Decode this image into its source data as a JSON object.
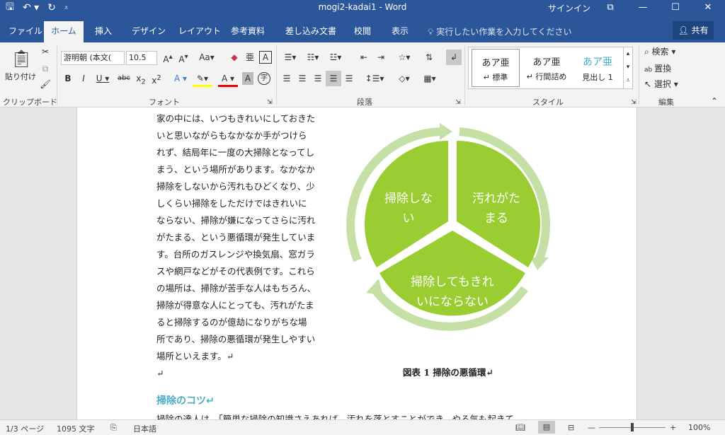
{
  "window": {
    "title": "mogi2-kadai1  -  Word",
    "signin": "サインイン"
  },
  "tabs": [
    "ファイル",
    "ホーム",
    "挿入",
    "デザイン",
    "レイアウト",
    "参考資料",
    "差し込み文書",
    "校閲",
    "表示"
  ],
  "tellme": "実行したい作業を入力してください",
  "share": "共有",
  "ribbon": {
    "clipboard": {
      "paste": "貼り付け",
      "label": "クリップボード"
    },
    "font": {
      "name": "游明朝 (本文(",
      "size": "10.5",
      "label": "フォント"
    },
    "paragraph": {
      "label": "段落"
    },
    "styles": {
      "label": "スタイル",
      "items": [
        {
          "sample": "あア亜",
          "name": "↵ 標準"
        },
        {
          "sample": "あア亜",
          "name": "↵ 行間詰め"
        },
        {
          "sample": "あア亜",
          "name": "見出し 1"
        }
      ]
    },
    "editing": {
      "search": "検索",
      "replace": "置換",
      "select": "選択",
      "label": "編集"
    }
  },
  "document": {
    "lines": [
      "家の中には、いつもきれいにしておきた",
      "いと思いながらもなかなか手がつけら",
      "れず、結局年に一度の大掃除となってし",
      "まう、という場所があります。なかなか",
      "掃除をしないから汚れもひどくなり、少",
      "しくらい掃除をしただけではきれいに",
      "ならない、掃除が嫌になってさらに汚れ",
      "がたまる、という悪循環が発生していま",
      "す。台所のガスレンジや換気扇、窓ガラ",
      "スや網戸などがその代表例です。これら",
      "の場所は、掃除が苦手な人はもちろん、",
      "掃除が得意な人にとっても、汚れがたま",
      "ると掃除するのが億劫になりがちな場",
      "所であり、掃除の悪循環が発生しやすい",
      "場所といえます。↵",
      "↵"
    ],
    "cycle": [
      {
        "line1": "汚れがた",
        "line2": "まる"
      },
      {
        "line1": "掃除してもきれ",
        "line2": "いにならない"
      },
      {
        "line1": "掃除しな",
        "line2": "い"
      }
    ],
    "caption": "図表 1 掃除の悪循環↵",
    "heading": "掃除のコツ↵",
    "next_line": "掃除の達人は、「簡単な掃除の知識さえあれば、汚れを落とすことができ、やる気も起きて"
  },
  "colors": {
    "brand": "#2b579a",
    "cycle_fill": "#9acd32",
    "cycle_arrow": "#c5e0a5",
    "heading": "#4bacc6"
  },
  "status": {
    "page": "1/3 ページ",
    "words": "1095 文字",
    "lang": "日本語",
    "zoom": "100%"
  }
}
